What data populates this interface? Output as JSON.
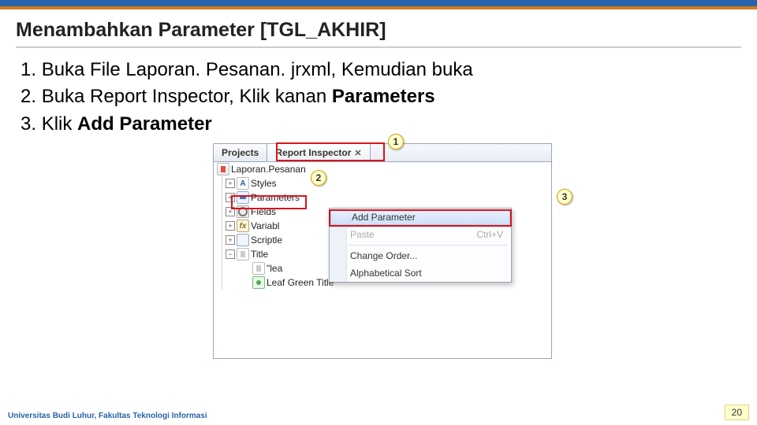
{
  "title": "Menambahkan Parameter [TGL_AKHIR]",
  "steps": [
    "Buka File Laporan. Pesanan. jrxml, Kemudian buka",
    "Buka Report Inspector, Klik kanan <b>Parameters</b>",
    "Klik <b>Add Parameter</b>"
  ],
  "tabs": {
    "projects": "Projects",
    "inspector": "Report Inspector"
  },
  "tree": {
    "root": "Laporan.Pesanan",
    "nodes": {
      "styles": "Styles",
      "parameters": "Parameters",
      "fields": "Fields",
      "variables": "Variabl",
      "scriptlets": "Scriptle",
      "title": "Title",
      "leaf1": "\"lea",
      "leaf2": "Leaf Green Title"
    }
  },
  "menu": {
    "add": "Add Parameter",
    "paste": "Paste",
    "paste_key": "Ctrl+V",
    "order": "Change Order...",
    "alpha": "Alphabetical Sort"
  },
  "callouts": {
    "c1": "1",
    "c2": "2",
    "c3": "3"
  },
  "footer": "Universitas Budi Luhur, Fakultas Teknologi Informasi",
  "page": "20"
}
